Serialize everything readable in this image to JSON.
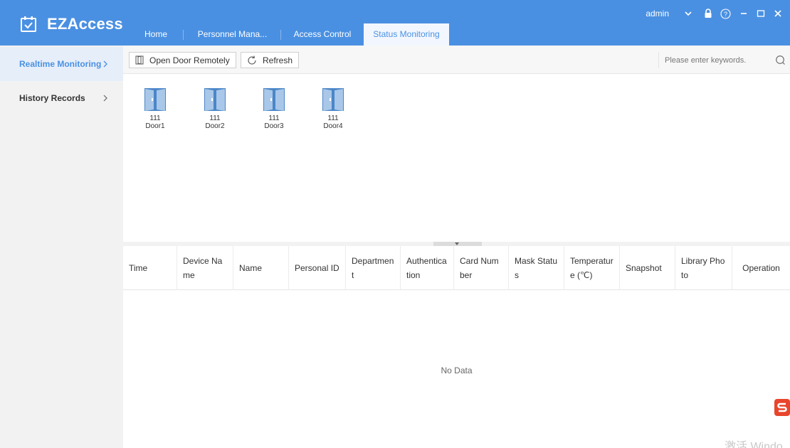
{
  "app": {
    "title": "EZAccess"
  },
  "header": {
    "tabs": [
      {
        "label": "Home"
      },
      {
        "label": "Personnel Mana..."
      },
      {
        "label": "Access Control"
      },
      {
        "label": "Status Monitoring"
      }
    ],
    "active_tab": "Status Monitoring",
    "user": "admin",
    "icons": [
      "chevron-down-icon",
      "lock-icon",
      "help-icon",
      "minimize-icon",
      "maximize-icon",
      "close-icon"
    ]
  },
  "sidebar": {
    "items": [
      {
        "label": "Realtime Monitoring"
      },
      {
        "label": "History Records"
      }
    ],
    "active_item": "Realtime Monitoring"
  },
  "toolbar": {
    "open_door_label": "Open Door Remotely",
    "refresh_label": "Refresh",
    "search_placeholder": "Please enter keywords."
  },
  "doors": [
    {
      "number": "111",
      "name": "Door1"
    },
    {
      "number": "111",
      "name": "Door2"
    },
    {
      "number": "111",
      "name": "Door3"
    },
    {
      "number": "111",
      "name": "Door4"
    }
  ],
  "table": {
    "columns": [
      "Time",
      "Device Name",
      "Name",
      "Personal ID",
      "Department",
      "Authentication",
      "Card Number",
      "Mask Status",
      "Temperature (℃)",
      "Snapshot",
      "Library Photo",
      "Operation"
    ],
    "empty_text": "No Data"
  },
  "watermark": "激活 Windo",
  "colors": {
    "primary": "#4a90e2",
    "door_blue": "#4a86c8"
  }
}
